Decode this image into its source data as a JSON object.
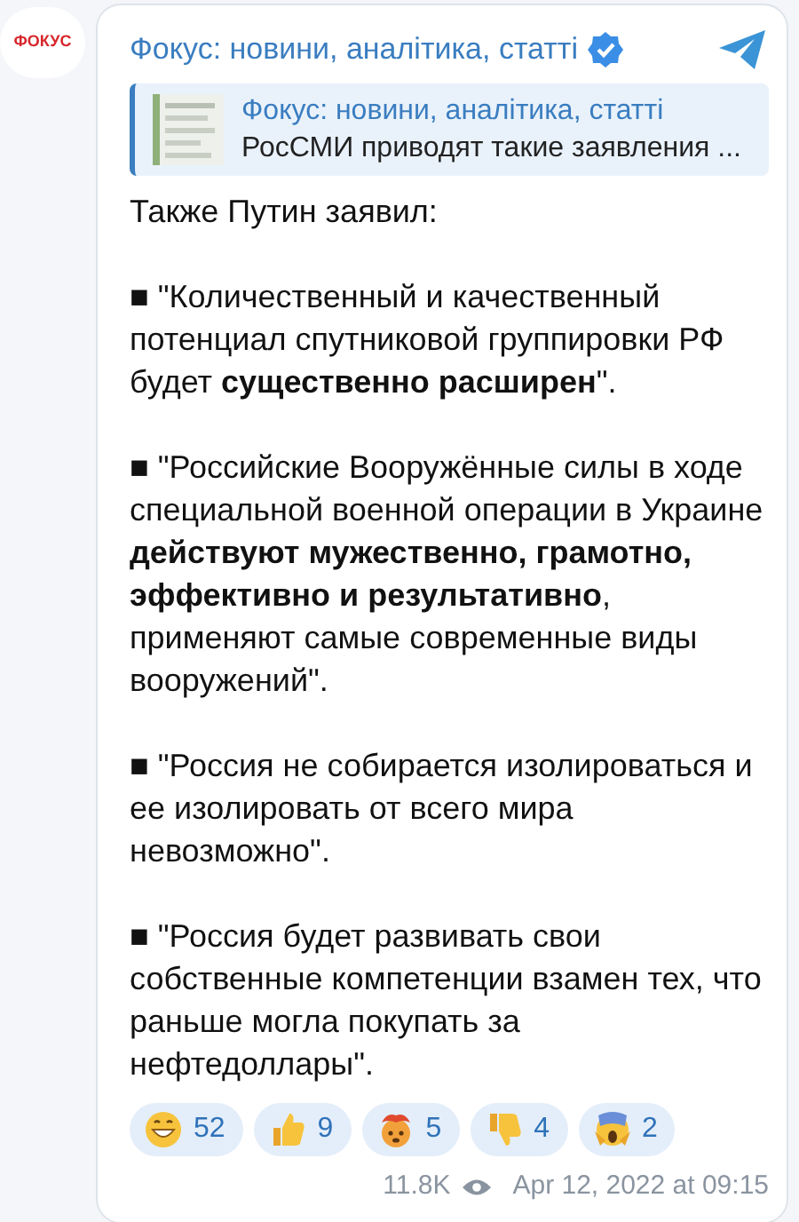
{
  "avatar": {
    "label": "ФОКУС"
  },
  "post": {
    "channel": "Фокус: новини, аналітика, статті",
    "verified": true,
    "reply": {
      "title": "Фокус: новини, аналітика, статті",
      "text": "РосСМИ приводят такие заявления ..."
    },
    "paragraphs": [
      "Также Путин заявил:",
      "■  \"Количественный и качественный потенциал спутниковой группировки РФ будет **существенно расширен**\".",
      "■  \"Российские Вооружённые силы в ходе специальной военной операции в Украине **действуют мужественно, грамотно, эффективно и результативно**, применяют самые современные виды вооружений\".",
      "■ \"Россия не собирается изолироваться и ее изолировать от всего мира невозможно\".",
      "■ \"Россия будет развивать свои собственные компетенции взамен тех, что раньше могла покупать за нефтедоллары\"."
    ],
    "reactions": [
      {
        "kind": "grin",
        "count": "52"
      },
      {
        "kind": "thumbs_up",
        "count": "9"
      },
      {
        "kind": "exploding_head",
        "count": "5"
      },
      {
        "kind": "thumbs_down",
        "count": "4"
      },
      {
        "kind": "scream",
        "count": "2"
      }
    ],
    "views": "11.8K",
    "date": "Apr 12, 2022 at 09:15"
  }
}
